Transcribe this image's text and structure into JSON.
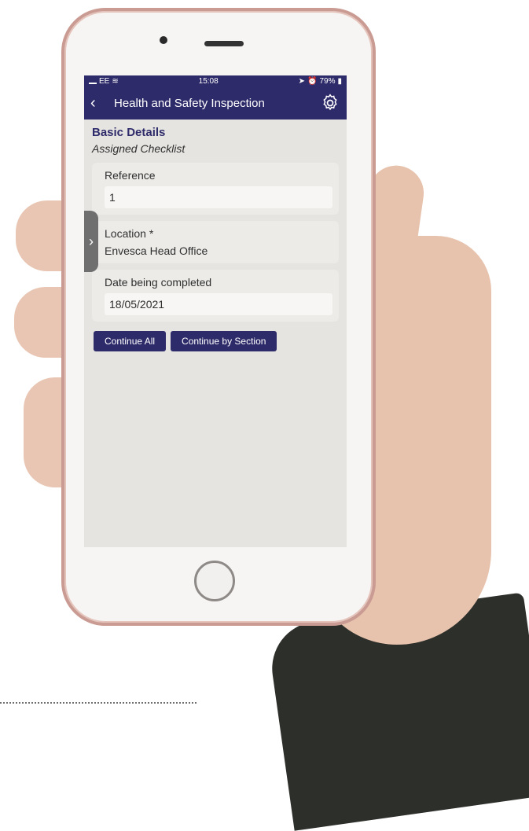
{
  "status_bar": {
    "carrier": "EE",
    "time": "15:08",
    "battery": "79%"
  },
  "nav": {
    "title": "Health and Safety Inspection"
  },
  "form": {
    "section_title": "Basic Details",
    "subtitle": "Assigned Checklist",
    "reference": {
      "label": "Reference",
      "value": "1"
    },
    "location": {
      "label": "Location *",
      "value": "Envesca Head Office"
    },
    "date": {
      "label": "Date being completed",
      "value": "18/05/2021"
    }
  },
  "actions": {
    "continue_all": "Continue All",
    "continue_by_section": "Continue by Section"
  },
  "icons": {
    "back": "chevron-left-icon",
    "settings": "gear-icon",
    "side_handle": "chevron-right-icon"
  },
  "colors": {
    "brand": "#2e2b6a"
  }
}
